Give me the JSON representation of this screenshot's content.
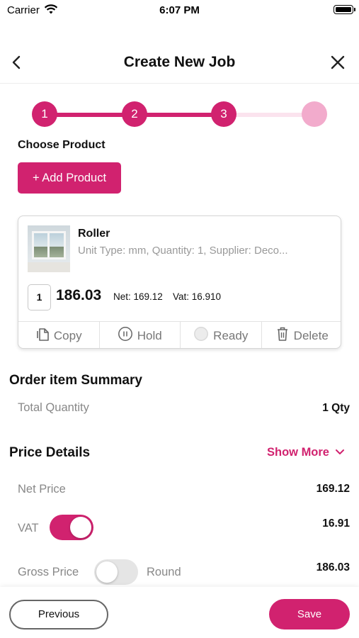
{
  "status_bar": {
    "carrier": "Carrier",
    "time": "6:07 PM"
  },
  "header": {
    "title": "Create New Job"
  },
  "stepper": {
    "steps": [
      "1",
      "2",
      "3",
      ""
    ],
    "current": 3
  },
  "product_section": {
    "label": "Choose Product",
    "add_button": "+ Add Product"
  },
  "product_card": {
    "name": "Roller",
    "description": "Unit Type: mm, Quantity: 1, Supplier: Deco...",
    "quantity": "1",
    "price": "186.03",
    "net": "Net: 169.12",
    "vat": "Vat: 16.910",
    "actions": {
      "copy": "Copy",
      "hold": "Hold",
      "ready": "Ready",
      "delete": "Delete"
    }
  },
  "summary": {
    "title": "Order item Summary",
    "total_quantity_label": "Total Quantity",
    "total_quantity_value": "1 Qty"
  },
  "price_details": {
    "title": "Price Details",
    "show_more": "Show More",
    "net_price_label": "Net Price",
    "net_price_value": "169.12",
    "vat_label": "VAT",
    "vat_value": "16.91",
    "vat_enabled": true,
    "gross_price_label": "Gross Price",
    "round_label": "Round",
    "round_enabled": false,
    "gross_price_value": "186.03"
  },
  "footer": {
    "previous": "Previous",
    "save": "Save"
  },
  "colors": {
    "accent": "#d1226f",
    "accent_light": "#f2abcc"
  }
}
